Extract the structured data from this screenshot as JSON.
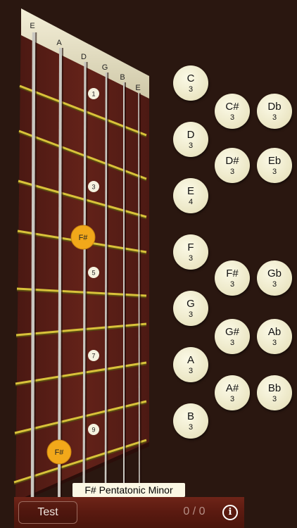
{
  "fretboard": {
    "string_names": [
      "E",
      "A",
      "D",
      "G",
      "B",
      "E"
    ],
    "inlay_markers": [
      "1",
      "3",
      "5",
      "7",
      "9"
    ],
    "highlighted_notes": [
      "F#",
      "F#"
    ],
    "colors": {
      "highlight": "#f2a81a",
      "fret": "#d8c23a",
      "wood": "#5a1e17"
    }
  },
  "note_buttons": [
    {
      "name": "C",
      "octave": "3"
    },
    {
      "name": "C#",
      "octave": "3"
    },
    {
      "name": "Db",
      "octave": "3"
    },
    {
      "name": "D",
      "octave": "3"
    },
    {
      "name": "D#",
      "octave": "3"
    },
    {
      "name": "Eb",
      "octave": "3"
    },
    {
      "name": "E",
      "octave": "4"
    },
    {
      "name": "F",
      "octave": "3"
    },
    {
      "name": "F#",
      "octave": "3"
    },
    {
      "name": "Gb",
      "octave": "3"
    },
    {
      "name": "G",
      "octave": "3"
    },
    {
      "name": "G#",
      "octave": "3"
    },
    {
      "name": "Ab",
      "octave": "3"
    },
    {
      "name": "A",
      "octave": "3"
    },
    {
      "name": "A#",
      "octave": "3"
    },
    {
      "name": "Bb",
      "octave": "3"
    },
    {
      "name": "B",
      "octave": "3"
    }
  ],
  "scale_label": "F# Pentatonic Minor",
  "bottom_bar": {
    "test_label": "Test",
    "score": "0 / 0",
    "info_symbol": "i"
  }
}
